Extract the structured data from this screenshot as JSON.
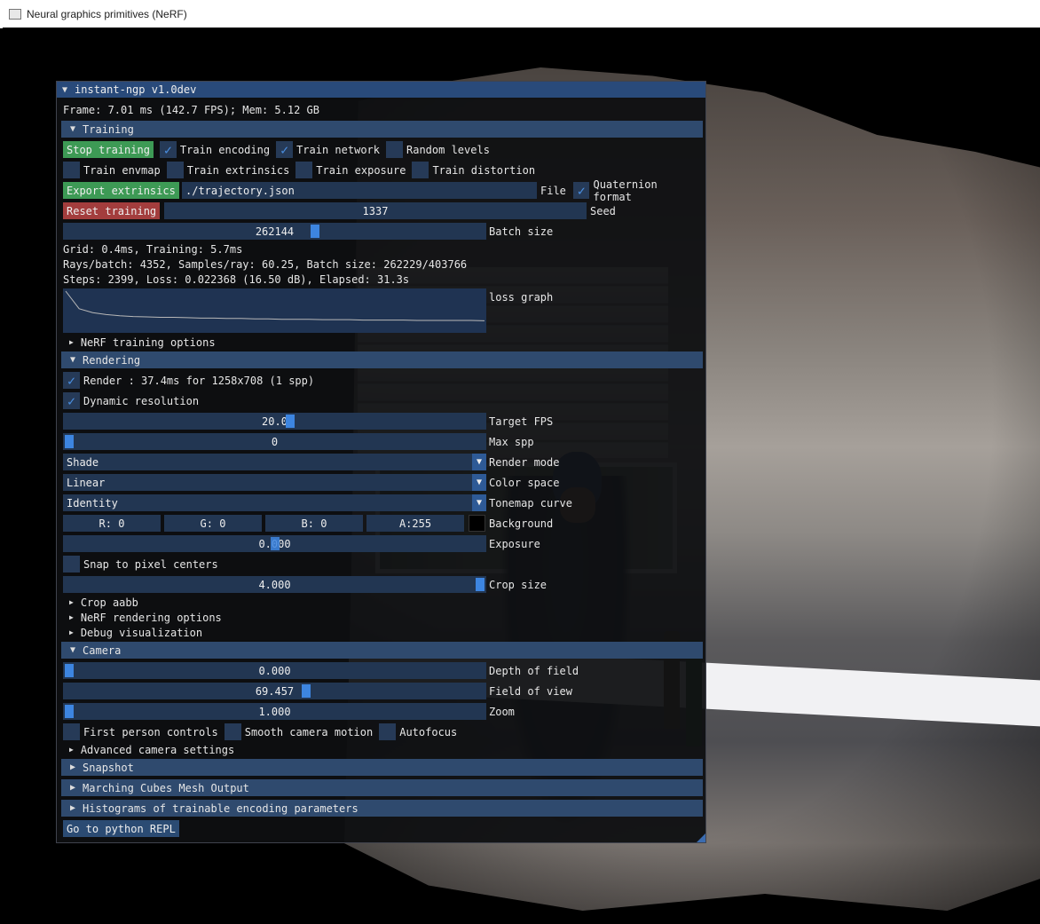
{
  "window": {
    "title": "Neural graphics primitives (NeRF)"
  },
  "panel": {
    "title": "instant-ngp v1.0dev",
    "frame_info": "Frame: 7.01 ms (142.7 FPS); Mem: 5.12 GB",
    "training": {
      "header": "Training",
      "stop_training": "Stop training",
      "train_encoding": "Train encoding",
      "train_network": "Train network",
      "random_levels": "Random levels",
      "train_envmap": "Train envmap",
      "train_extrinsics": "Train extrinsics",
      "train_exposure": "Train exposure",
      "train_distortion": "Train distortion",
      "export_extrinsics": "Export extrinsics",
      "file_value": "./trajectory.json",
      "file_label": "File",
      "quaternion_format": "Quaternion format",
      "reset_training": "Reset training",
      "seed_value": "1337",
      "seed_label": "Seed",
      "batch_value": "262144",
      "batch_label": "Batch size",
      "batch_fraction": 0.6,
      "timing": "Grid: 0.4ms, Training: 5.7ms",
      "rays": "Rays/batch: 4352, Samples/ray: 60.25, Batch size: 262229/403766",
      "steps": "Steps: 2399, Loss: 0.022368 (16.50 dB), Elapsed: 31.3s",
      "loss_label": "loss graph",
      "nerf_options": "NeRF training options"
    },
    "rendering": {
      "header": "Rendering",
      "render_info": "Render : 37.4ms for 1258x708 (1 spp)",
      "dynamic_resolution": "Dynamic resolution",
      "target_fps_value": "20.0",
      "target_fps_label": "Target FPS",
      "max_spp_value": "0",
      "max_spp_label": "Max spp",
      "render_mode_value": "Shade",
      "render_mode_label": "Render mode",
      "color_space_value": "Linear",
      "color_space_label": "Color space",
      "tonemap_value": "Identity",
      "tonemap_label": "Tonemap curve",
      "bg_r": "R:  0",
      "bg_g": "G:  0",
      "bg_b": "B:  0",
      "bg_a": "A:255",
      "background_label": "Background",
      "exposure_value": "0.000",
      "exposure_label": "Exposure",
      "snap": "Snap to pixel centers",
      "crop_value": "4.000",
      "crop_label": "Crop size",
      "crop_aabb": "Crop aabb",
      "nerf_render_options": "NeRF rendering options",
      "debug_vis": "Debug visualization"
    },
    "camera": {
      "header": "Camera",
      "dof_value": "0.000",
      "dof_label": "Depth of field",
      "fov_value": "69.457",
      "fov_label": "Field of view",
      "zoom_value": "1.000",
      "zoom_label": "Zoom",
      "first_person": "First person controls",
      "smooth_motion": "Smooth camera motion",
      "autofocus": "Autofocus",
      "advanced": "Advanced camera settings"
    },
    "snapshot": "Snapshot",
    "marching_cubes": "Marching Cubes Mesh Output",
    "histograms": "Histograms of trainable encoding parameters",
    "python_repl": "Go to python REPL"
  },
  "loss_curve": [
    1.0,
    0.55,
    0.45,
    0.4,
    0.37,
    0.35,
    0.34,
    0.33,
    0.33,
    0.32,
    0.31,
    0.31,
    0.3,
    0.3,
    0.29,
    0.29,
    0.28,
    0.28,
    0.28,
    0.27,
    0.27,
    0.27,
    0.26,
    0.26,
    0.26,
    0.26,
    0.25,
    0.25,
    0.25,
    0.25,
    0.25,
    0.24
  ]
}
